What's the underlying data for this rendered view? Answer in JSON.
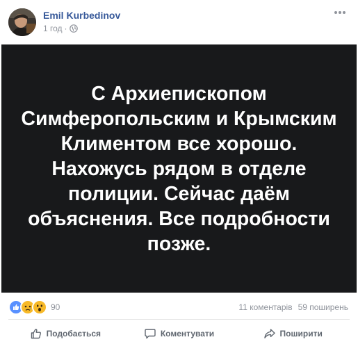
{
  "post": {
    "author": "Emil Kurbedinov",
    "time": "1 год",
    "separator": "·",
    "privacy_icon": "globe-icon",
    "image_text": "С Архиепископом Симферопольским и Крымским Климентом все хорошо. Нахожусь рядом в отделе полиции. Сейчас даём объяснения. Все подробности позже."
  },
  "stats": {
    "reactions": [
      "like",
      "sad",
      "wow"
    ],
    "reaction_count": "90",
    "comments": "11 коментарів",
    "shares": "59 поширень"
  },
  "actions": {
    "like": "Подобається",
    "comment": "Коментувати",
    "share": "Поширити"
  },
  "colors": {
    "author_link": "#365899",
    "meta": "#90949c",
    "image_bg": "#18191b",
    "like_blue": "#5890ff",
    "reaction_yellow": "#f7b928"
  }
}
